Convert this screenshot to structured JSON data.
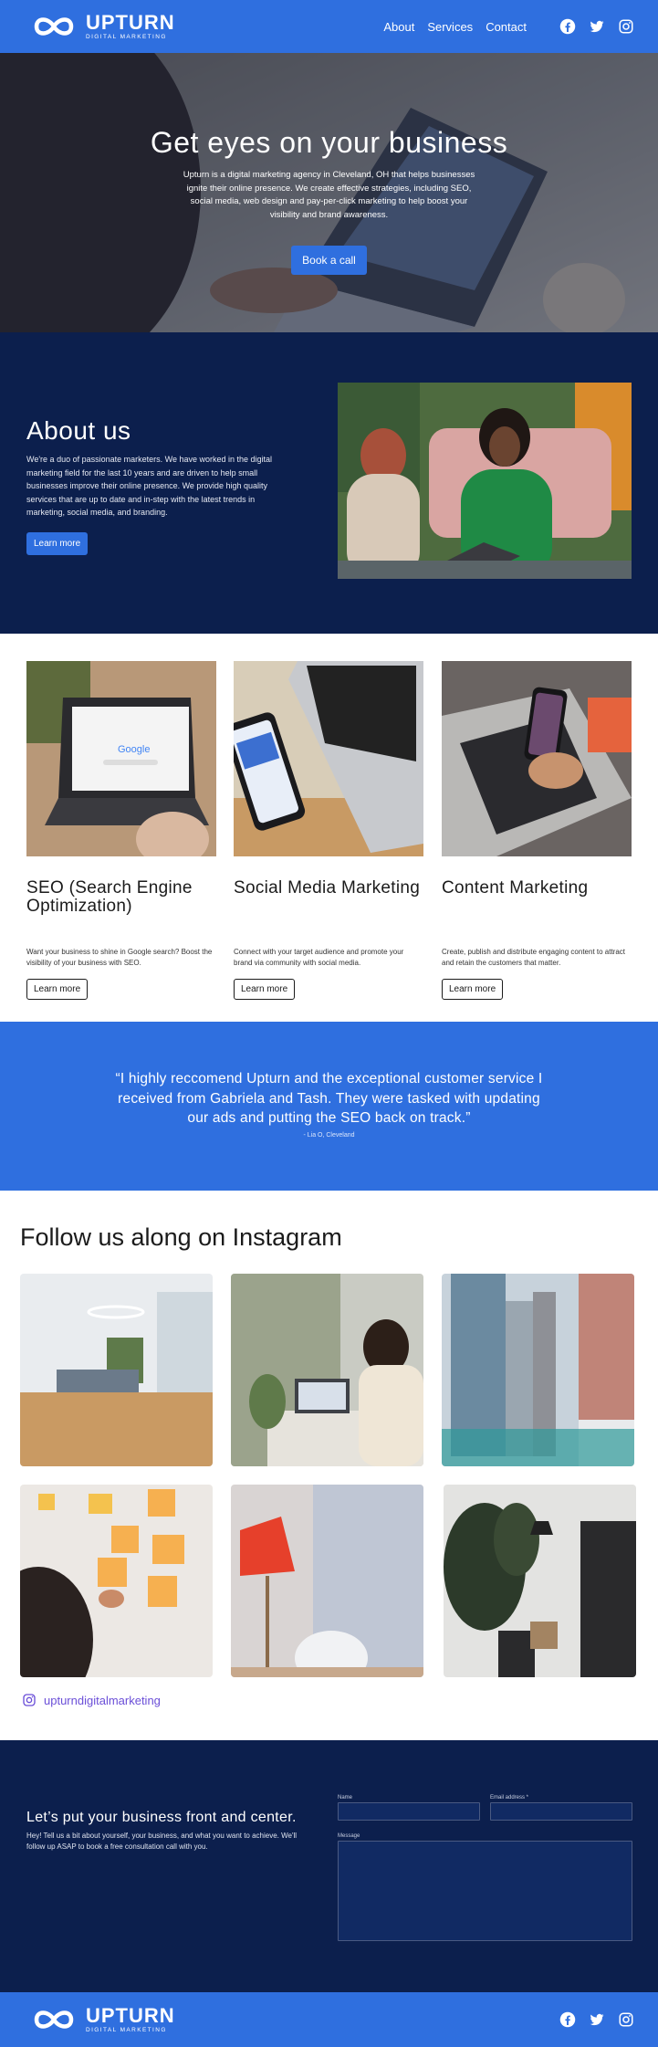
{
  "brand": {
    "name": "UPTURN",
    "tagline": "DIGITAL MARKETING",
    "color": "#2f6fdf",
    "navy": "#0c1f4d"
  },
  "nav": {
    "items": [
      "About",
      "Services",
      "Contact"
    ]
  },
  "social": {
    "icons": [
      "facebook-icon",
      "twitter-icon",
      "instagram-icon"
    ]
  },
  "hero": {
    "title": "Get eyes on your business",
    "subtitle": "Upturn is a digital marketing agency in Cleveland, OH that helps businesses ignite their online presence. We create effective strategies, including SEO, social media, web design and pay-per-click marketing to help boost your visibility and brand awareness.",
    "cta": "Book a call"
  },
  "about": {
    "title": "About us",
    "body": "We're a duo of passionate marketers. We have worked in the digital marketing field for the last 10 years and are driven to help small businesses improve their online presence. We provide high quality services that are up to date and in-step with the latest trends in marketing, social media, and branding.",
    "cta": "Learn more"
  },
  "services": [
    {
      "title": "SEO (Search Engine Optimization)",
      "desc": "Want your business to shine in Google search? Boost the visibility of your business with SEO.",
      "cta": "Learn more"
    },
    {
      "title": "Social Media Marketing",
      "desc": "Connect with your target audience and promote your brand via community with social media.",
      "cta": "Learn more"
    },
    {
      "title": "Content Marketing",
      "desc": "Create, publish and distribute engaging content to attract and retain the customers that matter.",
      "cta": "Learn more"
    }
  ],
  "testimonial": {
    "quote": "“I highly reccomend Upturn and the exceptional customer service I received from Gabriela and Tash. They were tasked with updating our ads and putting the SEO back on track.”",
    "author": "- Lia O, Cleveland"
  },
  "instagram": {
    "title": "Follow us along on Instagram",
    "handle": "upturndigitalmarketing"
  },
  "contact": {
    "title": "Let’s put your business front and center.",
    "body": "Hey! Tell us a bit about yourself, your business, and what you want to achieve. We'll follow up ASAP to book a free consultation call with you.",
    "name_label": "Name",
    "email_label": "Email address *",
    "message_label": "Message"
  }
}
